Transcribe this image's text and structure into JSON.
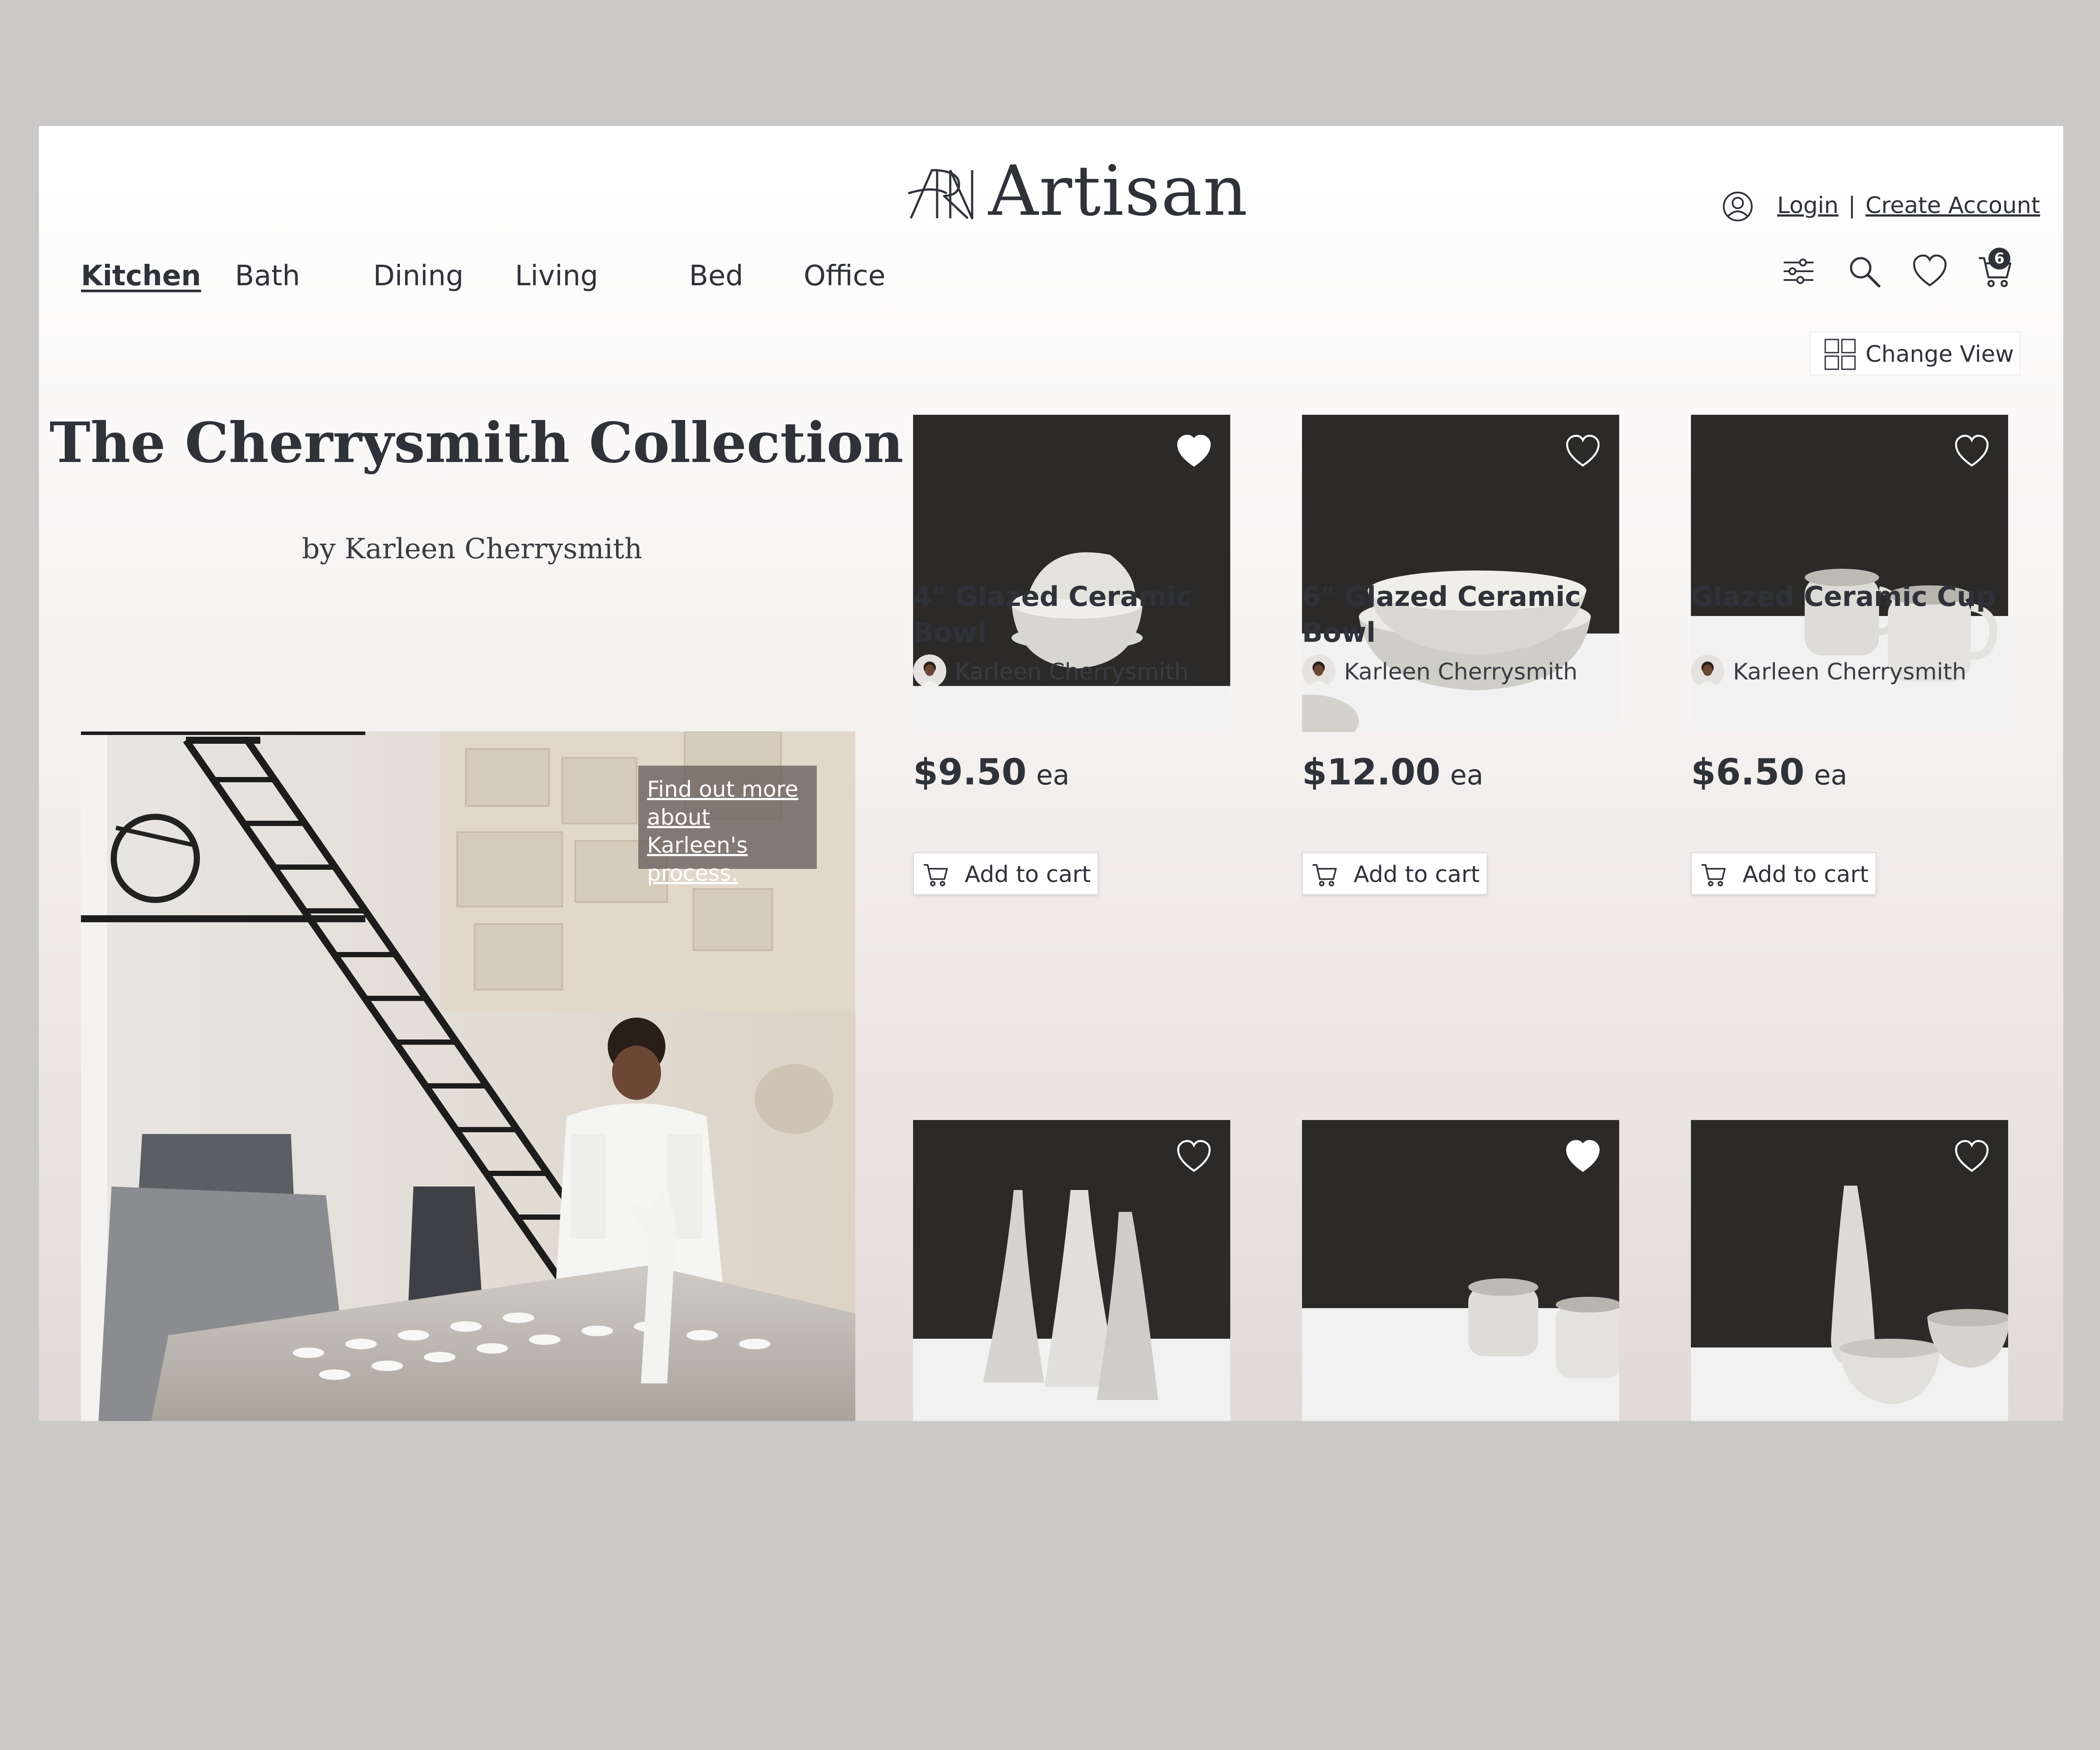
{
  "brand": {
    "name": "Artisan"
  },
  "account": {
    "login_label": "Login",
    "separator": "|",
    "create_label": "Create Account",
    "icon": "user-circle-icon"
  },
  "nav": {
    "items": [
      "Kitchen",
      "Bath",
      "Dining",
      "Living",
      "Bed",
      "Office"
    ],
    "active": "Kitchen"
  },
  "tools": {
    "icons": [
      "filter-sliders-icon",
      "search-icon",
      "heart-icon",
      "cart-icon"
    ],
    "cart_count": "6"
  },
  "view": {
    "change_view_label": "Change View",
    "icon": "grid-icon"
  },
  "collection": {
    "title": "The Cherrysmith Collection",
    "byline": "by Karleen Cherrysmith",
    "process_link": "Find out more about Karleen's process."
  },
  "products": [
    {
      "name": "4\" Glazed Ceramic Bowl",
      "artist": "Karleen Cherrysmith",
      "price": "$9.50",
      "unit": "ea",
      "add_label": "Add to cart",
      "favorited": true
    },
    {
      "name": "6\" Glazed Ceramic Bowl",
      "artist": "Karleen Cherrysmith",
      "price": "$12.00",
      "unit": "ea",
      "add_label": "Add to cart",
      "favorited": false
    },
    {
      "name": "Glazed Ceramic Cup",
      "artist": "Karleen Cherrysmith",
      "price": "$6.50",
      "unit": "ea",
      "add_label": "Add to cart",
      "favorited": false
    },
    {
      "favorited": false
    },
    {
      "favorited": true
    },
    {
      "favorited": false
    }
  ],
  "colors": {
    "text": "#2f3239",
    "photo_dark": "#2b2a29",
    "photo_table": "#f1f1f1",
    "page_bg": "#cbc9c7"
  }
}
